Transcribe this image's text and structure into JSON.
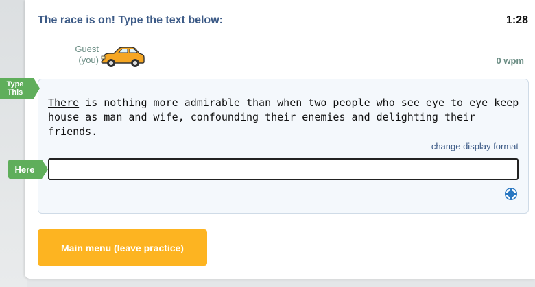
{
  "race": {
    "title": "The race is on! Type the text below:",
    "timer": "1:28"
  },
  "player": {
    "name": "Guest",
    "tag": "(you)",
    "wpm": "0 wpm",
    "car_icon": "car-icon",
    "car_color": "#f5a623"
  },
  "labels": {
    "type_this": "Type This",
    "here": "Here"
  },
  "passage": {
    "current_word": "There",
    "rest": " is nothing more admirable than when two people who see eye to eye keep house as man and wife, confounding their enemies and delighting their friends."
  },
  "controls": {
    "change_format": "change display format",
    "input_value": "",
    "help_icon": "help-icon",
    "main_menu": "Main menu (leave practice)"
  },
  "colors": {
    "title": "#3c5a86",
    "label_green": "#5fae5b",
    "button_orange": "#fdb421",
    "track_dash": "#f0b92e"
  }
}
